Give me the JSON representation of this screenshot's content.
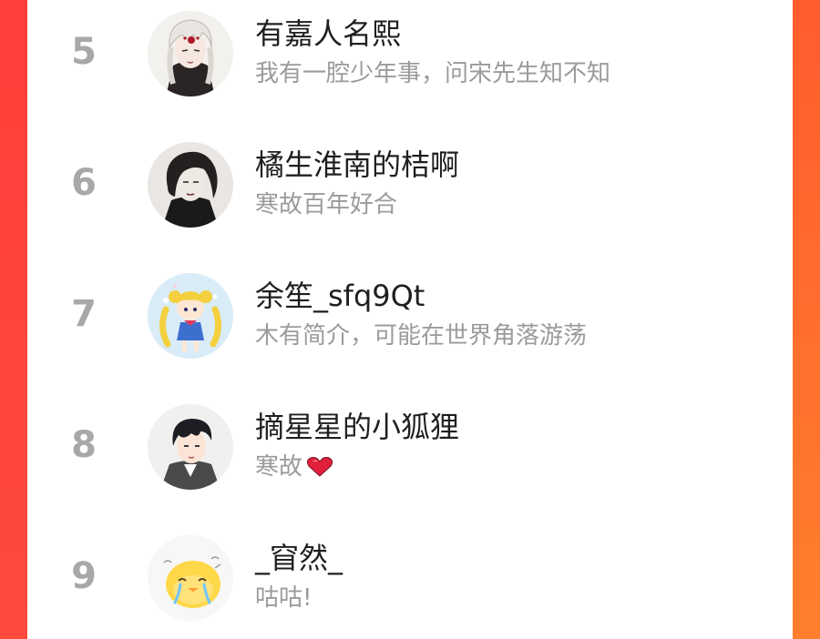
{
  "list": [
    {
      "rank": "5",
      "name": "有嘉人名熙",
      "bio": "我有一腔少年事，问宋先生知不知",
      "avatar": "avatar-white-hair-man"
    },
    {
      "rank": "6",
      "name": "橘生淮南的桔啊",
      "bio": "寒故百年好合",
      "avatar": "avatar-dark-hair-man"
    },
    {
      "rank": "7",
      "name": "余笙_sfq9Qt",
      "bio": "木有简介，可能在世界角落游荡",
      "avatar": "avatar-sailor-girl"
    },
    {
      "rank": "8",
      "name": "摘星星的小狐狸",
      "bio": "寒故",
      "avatar": "avatar-anime-boy",
      "bio_icon": "heart-icon"
    },
    {
      "rank": "9",
      "name": "_窅然_",
      "bio": "咕咕!",
      "avatar": "avatar-crying-chick"
    }
  ],
  "colors": {
    "rank": "#a8a8a8",
    "name": "#1f1f1f",
    "bio": "#9b9b9b",
    "heart": "#e0203a",
    "background_left": "#ff4a3d",
    "background_right": "#ff7a33"
  }
}
